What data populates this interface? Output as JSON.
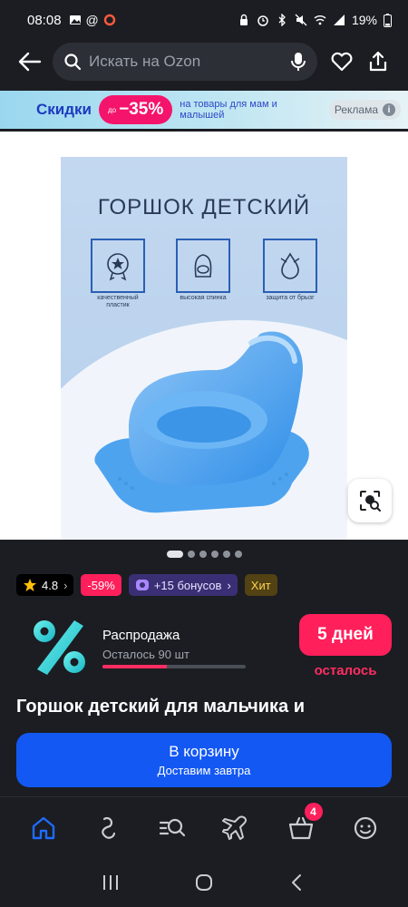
{
  "status_bar": {
    "time": "08:08",
    "battery": "19%"
  },
  "header": {
    "search_placeholder": "Искать на Ozon"
  },
  "promo": {
    "title": "Скидки",
    "discount_prefix": "до",
    "discount": "−35%",
    "subtitle": "на товары для мам и малышей",
    "ad_label": "Реклама",
    "ad_info": "i"
  },
  "product_image": {
    "heading": "ГОРШОК ДЕТСКИЙ",
    "features": [
      "качественный пластик",
      "высокая спинка",
      "защита от брызг"
    ],
    "active_slide": 1,
    "slide_count": 6
  },
  "badges": {
    "rating": "4.8",
    "discount": "-59%",
    "bonus": "+15 бонусов",
    "hit": "Хит"
  },
  "sale": {
    "title": "Распродажа",
    "stock_left": "Осталось 90 шт",
    "progress": 0.45,
    "days_badge": "5 дней",
    "days_sub": "осталось"
  },
  "product_title": "Горшок детский для мальчика и",
  "cart_button": {
    "label": "В корзину",
    "sublabel": "Доставим завтра"
  },
  "tabbar": {
    "cart_count": "4",
    "items": [
      "home-icon",
      "catalog-icon",
      "search-history-icon",
      "travel-icon",
      "cart-icon",
      "profile-icon"
    ]
  },
  "colors": {
    "accent_blue": "#1358f2",
    "accent_pink": "#ff1f5b",
    "background": "#1b1d22"
  }
}
